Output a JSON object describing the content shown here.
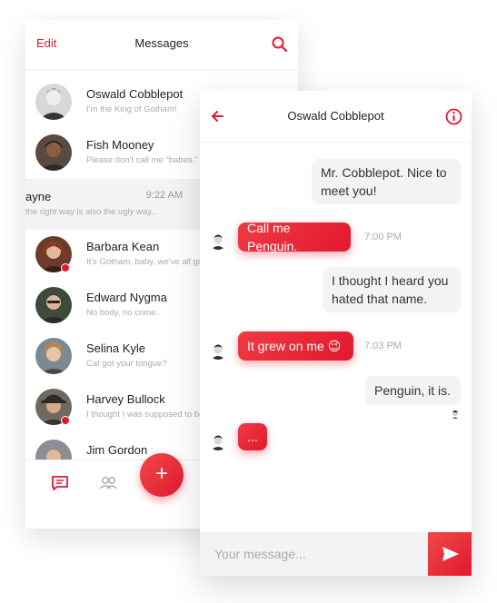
{
  "list": {
    "edit_label": "Edit",
    "title": "Messages",
    "conversations": [
      {
        "name": "Oswald Cobblepot",
        "preview": "I'm the King of Gotham!",
        "time": "",
        "unread": false
      },
      {
        "name": "Fish Mooney",
        "preview": "Please don't call me \"babes.\"",
        "time": "",
        "unread": false
      },
      {
        "name": "ayne",
        "preview": " the right way is also the ugly way..",
        "time": "9:22 AM",
        "unread": false
      },
      {
        "name": "Barbara Kean",
        "preview": "It's Gotham, baby, we've all go",
        "time": "",
        "unread": true
      },
      {
        "name": "Edward Nygma",
        "preview": "No body, no crime.",
        "time": "",
        "unread": false
      },
      {
        "name": "Selina Kyle",
        "preview": "Cat got your tongue?",
        "time": "",
        "unread": false
      },
      {
        "name": "Harvey Bullock",
        "preview": "I thought I was supposed to be",
        "time": "",
        "unread": true
      },
      {
        "name": "Jim Gordon",
        "preview": "",
        "time": "",
        "unread": false
      }
    ],
    "fab_label": "+"
  },
  "chat": {
    "title": "Oswald Cobblepot",
    "messages": [
      {
        "direction": "incoming",
        "text": "Mr. Cobblepot. Nice to meet you!",
        "time": ""
      },
      {
        "direction": "outgoing",
        "text": "Call me Penguin.",
        "time": "7:00 PM"
      },
      {
        "direction": "incoming",
        "text": "I thought I heard you hated that name.",
        "time": ""
      },
      {
        "direction": "outgoing",
        "text": "It grew on me 😉",
        "time": "7:03 PM"
      },
      {
        "direction": "incoming",
        "text": "Penguin, it is.",
        "time": ""
      },
      {
        "direction": "outgoing",
        "text": "...",
        "time": ""
      }
    ],
    "input_placeholder": "Your message..."
  },
  "colors": {
    "accent": "#e0192f",
    "bubble_incoming": "#f3f3f3",
    "text": "#222222",
    "muted": "#aaaaaa"
  },
  "icons": [
    "search-icon",
    "back-arrow-icon",
    "info-icon",
    "chat-bubble-icon",
    "contacts-icon",
    "send-icon",
    "plus-icon"
  ]
}
